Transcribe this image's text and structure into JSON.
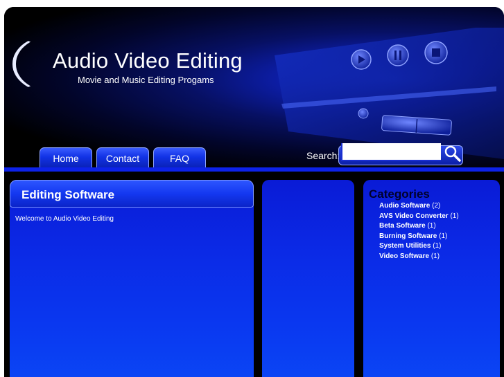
{
  "header": {
    "title": "Audio Video Editing",
    "tagline": "Movie and Music Editing Progams"
  },
  "nav": [
    {
      "label": "Home"
    },
    {
      "label": "Contact"
    },
    {
      "label": "FAQ"
    }
  ],
  "search": {
    "label": "Search:",
    "value": "",
    "placeholder": ""
  },
  "main": {
    "heading": "Editing Software",
    "welcome": "Welcome to Audio Video Editing"
  },
  "categories": {
    "title": "Categories",
    "items": [
      {
        "name": "Audio Software",
        "count": "(2)"
      },
      {
        "name": "AVS Video Converter",
        "count": "(1)"
      },
      {
        "name": "Beta Software",
        "count": "(1)"
      },
      {
        "name": "Burning Software",
        "count": "(1)"
      },
      {
        "name": "System Utilities",
        "count": "(1)"
      },
      {
        "name": "Video Software",
        "count": "(1)"
      }
    ]
  },
  "colors": {
    "accent": "#0d22e8",
    "background": "#000000",
    "panel": "#0b2ae6"
  }
}
